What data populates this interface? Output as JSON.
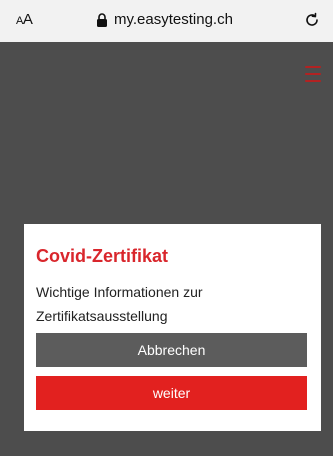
{
  "browser": {
    "text_size_label_small": "A",
    "text_size_label_large": "A",
    "url": "my.easytesting.ch",
    "lock_icon": "lock-icon",
    "reload_icon": "reload-icon"
  },
  "page": {
    "menu_icon": "hamburger-menu-icon",
    "accent_color": "#b22222",
    "overlay_color": "#4d4d4d"
  },
  "modal": {
    "title": "Covid-Zertifikat",
    "body_line1": "Wichtige Informationen zur",
    "body_line2": "Zertifikatsausstellung",
    "cancel_label": "Abbrechen",
    "next_label": "weiter",
    "title_color": "#d9262c",
    "cancel_color": "#5c5c5c",
    "next_color": "#e2211f"
  }
}
